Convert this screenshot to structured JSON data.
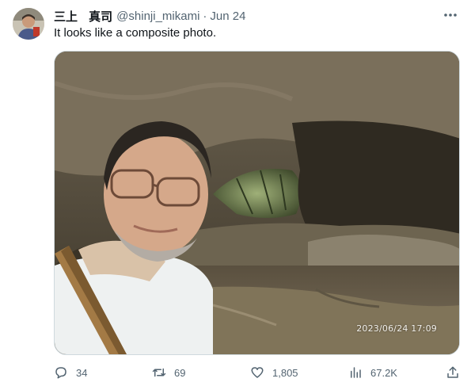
{
  "tweet": {
    "display_name": "三上 真司",
    "handle": "@shinji_mikami",
    "separator": "·",
    "date": "Jun 24",
    "text": "It looks like a composite photo."
  },
  "media": {
    "timestamp_overlay": "2023/06/24 17:09"
  },
  "actions": {
    "replies": "34",
    "retweets": "69",
    "likes": "1,805",
    "views": "67.2K"
  },
  "icons": {
    "reply": "speech-bubble-icon",
    "retweet": "retweet-icon",
    "like": "heart-icon",
    "views": "bar-chart-icon",
    "share": "share-upload-icon",
    "more": "more-horizontal-icon"
  },
  "colors": {
    "text_primary": "#0f1419",
    "text_secondary": "#536471",
    "border": "#cfd9de"
  }
}
